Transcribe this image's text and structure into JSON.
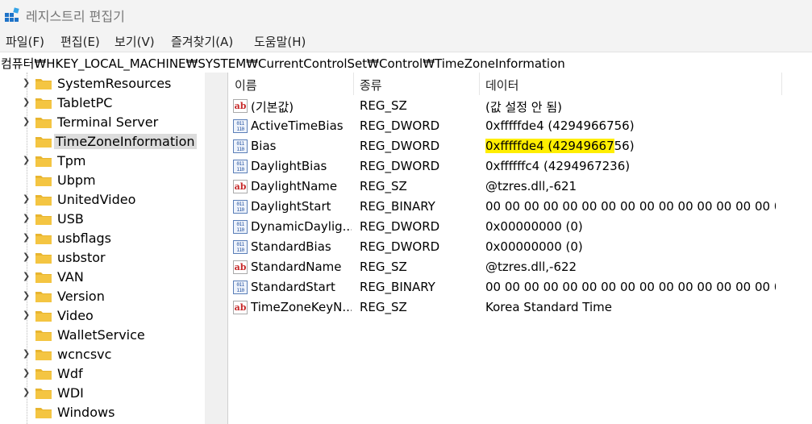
{
  "window": {
    "title": "레지스트리 편집기"
  },
  "menu": [
    "파일(F)",
    "편집(E)",
    "보기(V)",
    "즐겨찾기(A)",
    "도움말(H)"
  ],
  "address": "컴퓨터₩HKEY_LOCAL_MACHINE₩SYSTEM₩CurrentControlSet₩Control₩TimeZoneInformation",
  "tree": {
    "items": [
      {
        "label": "SystemResources",
        "expandable": true
      },
      {
        "label": "TabletPC",
        "expandable": true
      },
      {
        "label": "Terminal Server",
        "expandable": true
      },
      {
        "label": "TimeZoneInformation",
        "expandable": false,
        "selected": true
      },
      {
        "label": "Tpm",
        "expandable": true
      },
      {
        "label": "Ubpm",
        "expandable": false
      },
      {
        "label": "UnitedVideo",
        "expandable": true
      },
      {
        "label": "USB",
        "expandable": true
      },
      {
        "label": "usbflags",
        "expandable": true
      },
      {
        "label": "usbstor",
        "expandable": true
      },
      {
        "label": "VAN",
        "expandable": true
      },
      {
        "label": "Version",
        "expandable": true
      },
      {
        "label": "Video",
        "expandable": true
      },
      {
        "label": "WalletService",
        "expandable": false
      },
      {
        "label": "wcncsvc",
        "expandable": true
      },
      {
        "label": "Wdf",
        "expandable": true
      },
      {
        "label": "WDI",
        "expandable": true
      },
      {
        "label": "Windows",
        "expandable": false
      }
    ]
  },
  "list": {
    "columns": [
      "이름",
      "종류",
      "데이터"
    ],
    "rows": [
      {
        "icon": "string-value-icon",
        "name": "(기본값)",
        "type": "REG_SZ",
        "data": "(값 설정 안 됨)"
      },
      {
        "icon": "binary-value-icon",
        "name": "ActiveTimeBias",
        "type": "REG_DWORD",
        "data": "0xfffffde4 (4294966756)"
      },
      {
        "icon": "binary-value-icon",
        "name": "Bias",
        "type": "REG_DWORD",
        "data": "0xfffffde4 (4294966756)",
        "highlight": "0xfffffde4 (42949667"
      },
      {
        "icon": "binary-value-icon",
        "name": "DaylightBias",
        "type": "REG_DWORD",
        "data": "0xffffffc4 (4294967236)"
      },
      {
        "icon": "string-value-icon",
        "name": "DaylightName",
        "type": "REG_SZ",
        "data": "@tzres.dll,-621"
      },
      {
        "icon": "binary-value-icon",
        "name": "DaylightStart",
        "type": "REG_BINARY",
        "data": "00 00 00 00 00 00 00 00 00 00 00 00 00 00 00 0..."
      },
      {
        "icon": "binary-value-icon",
        "name": "DynamicDaylig...",
        "type": "REG_DWORD",
        "data": "0x00000000 (0)"
      },
      {
        "icon": "binary-value-icon",
        "name": "StandardBias",
        "type": "REG_DWORD",
        "data": "0x00000000 (0)"
      },
      {
        "icon": "string-value-icon",
        "name": "StandardName",
        "type": "REG_SZ",
        "data": "@tzres.dll,-622"
      },
      {
        "icon": "binary-value-icon",
        "name": "StandardStart",
        "type": "REG_BINARY",
        "data": "00 00 00 00 00 00 00 00 00 00 00 00 00 00 00 0..."
      },
      {
        "icon": "string-value-icon",
        "name": "TimeZoneKeyN...",
        "type": "REG_SZ",
        "data": "Korea Standard Time"
      }
    ]
  },
  "colors": {
    "highlight": "#ffee00",
    "selection": "#dcdcdc",
    "folder": "#f4c542"
  }
}
